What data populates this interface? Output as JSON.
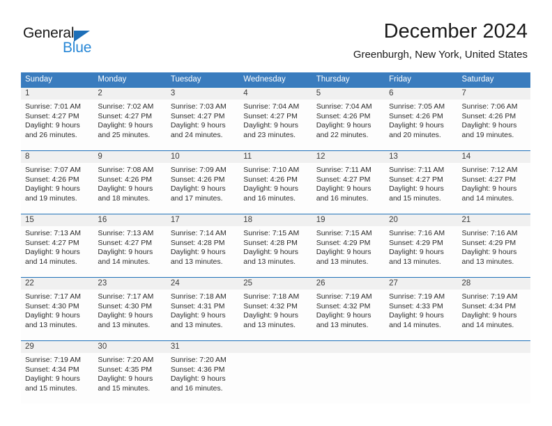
{
  "brand": {
    "name_part1": "General",
    "name_part2": "Blue",
    "accent_color": "#2787d6",
    "triangle_color": "#1d6fb8"
  },
  "header": {
    "title": "December 2024",
    "subtitle": "Greenburgh, New York, United States"
  },
  "calendar": {
    "header_bg": "#3a7cbe",
    "row_divider_color": "#1d6fb8",
    "daynum_bg": "#f0f0f0",
    "weekdays": [
      "Sunday",
      "Monday",
      "Tuesday",
      "Wednesday",
      "Thursday",
      "Friday",
      "Saturday"
    ],
    "weeks": [
      [
        {
          "day": "1",
          "sunrise": "Sunrise: 7:01 AM",
          "sunset": "Sunset: 4:27 PM",
          "daylight_1": "Daylight: 9 hours",
          "daylight_2": "and 26 minutes."
        },
        {
          "day": "2",
          "sunrise": "Sunrise: 7:02 AM",
          "sunset": "Sunset: 4:27 PM",
          "daylight_1": "Daylight: 9 hours",
          "daylight_2": "and 25 minutes."
        },
        {
          "day": "3",
          "sunrise": "Sunrise: 7:03 AM",
          "sunset": "Sunset: 4:27 PM",
          "daylight_1": "Daylight: 9 hours",
          "daylight_2": "and 24 minutes."
        },
        {
          "day": "4",
          "sunrise": "Sunrise: 7:04 AM",
          "sunset": "Sunset: 4:27 PM",
          "daylight_1": "Daylight: 9 hours",
          "daylight_2": "and 23 minutes."
        },
        {
          "day": "5",
          "sunrise": "Sunrise: 7:04 AM",
          "sunset": "Sunset: 4:26 PM",
          "daylight_1": "Daylight: 9 hours",
          "daylight_2": "and 22 minutes."
        },
        {
          "day": "6",
          "sunrise": "Sunrise: 7:05 AM",
          "sunset": "Sunset: 4:26 PM",
          "daylight_1": "Daylight: 9 hours",
          "daylight_2": "and 20 minutes."
        },
        {
          "day": "7",
          "sunrise": "Sunrise: 7:06 AM",
          "sunset": "Sunset: 4:26 PM",
          "daylight_1": "Daylight: 9 hours",
          "daylight_2": "and 19 minutes."
        }
      ],
      [
        {
          "day": "8",
          "sunrise": "Sunrise: 7:07 AM",
          "sunset": "Sunset: 4:26 PM",
          "daylight_1": "Daylight: 9 hours",
          "daylight_2": "and 19 minutes."
        },
        {
          "day": "9",
          "sunrise": "Sunrise: 7:08 AM",
          "sunset": "Sunset: 4:26 PM",
          "daylight_1": "Daylight: 9 hours",
          "daylight_2": "and 18 minutes."
        },
        {
          "day": "10",
          "sunrise": "Sunrise: 7:09 AM",
          "sunset": "Sunset: 4:26 PM",
          "daylight_1": "Daylight: 9 hours",
          "daylight_2": "and 17 minutes."
        },
        {
          "day": "11",
          "sunrise": "Sunrise: 7:10 AM",
          "sunset": "Sunset: 4:26 PM",
          "daylight_1": "Daylight: 9 hours",
          "daylight_2": "and 16 minutes."
        },
        {
          "day": "12",
          "sunrise": "Sunrise: 7:11 AM",
          "sunset": "Sunset: 4:27 PM",
          "daylight_1": "Daylight: 9 hours",
          "daylight_2": "and 16 minutes."
        },
        {
          "day": "13",
          "sunrise": "Sunrise: 7:11 AM",
          "sunset": "Sunset: 4:27 PM",
          "daylight_1": "Daylight: 9 hours",
          "daylight_2": "and 15 minutes."
        },
        {
          "day": "14",
          "sunrise": "Sunrise: 7:12 AM",
          "sunset": "Sunset: 4:27 PM",
          "daylight_1": "Daylight: 9 hours",
          "daylight_2": "and 14 minutes."
        }
      ],
      [
        {
          "day": "15",
          "sunrise": "Sunrise: 7:13 AM",
          "sunset": "Sunset: 4:27 PM",
          "daylight_1": "Daylight: 9 hours",
          "daylight_2": "and 14 minutes."
        },
        {
          "day": "16",
          "sunrise": "Sunrise: 7:13 AM",
          "sunset": "Sunset: 4:27 PM",
          "daylight_1": "Daylight: 9 hours",
          "daylight_2": "and 14 minutes."
        },
        {
          "day": "17",
          "sunrise": "Sunrise: 7:14 AM",
          "sunset": "Sunset: 4:28 PM",
          "daylight_1": "Daylight: 9 hours",
          "daylight_2": "and 13 minutes."
        },
        {
          "day": "18",
          "sunrise": "Sunrise: 7:15 AM",
          "sunset": "Sunset: 4:28 PM",
          "daylight_1": "Daylight: 9 hours",
          "daylight_2": "and 13 minutes."
        },
        {
          "day": "19",
          "sunrise": "Sunrise: 7:15 AM",
          "sunset": "Sunset: 4:29 PM",
          "daylight_1": "Daylight: 9 hours",
          "daylight_2": "and 13 minutes."
        },
        {
          "day": "20",
          "sunrise": "Sunrise: 7:16 AM",
          "sunset": "Sunset: 4:29 PM",
          "daylight_1": "Daylight: 9 hours",
          "daylight_2": "and 13 minutes."
        },
        {
          "day": "21",
          "sunrise": "Sunrise: 7:16 AM",
          "sunset": "Sunset: 4:29 PM",
          "daylight_1": "Daylight: 9 hours",
          "daylight_2": "and 13 minutes."
        }
      ],
      [
        {
          "day": "22",
          "sunrise": "Sunrise: 7:17 AM",
          "sunset": "Sunset: 4:30 PM",
          "daylight_1": "Daylight: 9 hours",
          "daylight_2": "and 13 minutes."
        },
        {
          "day": "23",
          "sunrise": "Sunrise: 7:17 AM",
          "sunset": "Sunset: 4:30 PM",
          "daylight_1": "Daylight: 9 hours",
          "daylight_2": "and 13 minutes."
        },
        {
          "day": "24",
          "sunrise": "Sunrise: 7:18 AM",
          "sunset": "Sunset: 4:31 PM",
          "daylight_1": "Daylight: 9 hours",
          "daylight_2": "and 13 minutes."
        },
        {
          "day": "25",
          "sunrise": "Sunrise: 7:18 AM",
          "sunset": "Sunset: 4:32 PM",
          "daylight_1": "Daylight: 9 hours",
          "daylight_2": "and 13 minutes."
        },
        {
          "day": "26",
          "sunrise": "Sunrise: 7:19 AM",
          "sunset": "Sunset: 4:32 PM",
          "daylight_1": "Daylight: 9 hours",
          "daylight_2": "and 13 minutes."
        },
        {
          "day": "27",
          "sunrise": "Sunrise: 7:19 AM",
          "sunset": "Sunset: 4:33 PM",
          "daylight_1": "Daylight: 9 hours",
          "daylight_2": "and 14 minutes."
        },
        {
          "day": "28",
          "sunrise": "Sunrise: 7:19 AM",
          "sunset": "Sunset: 4:34 PM",
          "daylight_1": "Daylight: 9 hours",
          "daylight_2": "and 14 minutes."
        }
      ],
      [
        {
          "day": "29",
          "sunrise": "Sunrise: 7:19 AM",
          "sunset": "Sunset: 4:34 PM",
          "daylight_1": "Daylight: 9 hours",
          "daylight_2": "and 15 minutes."
        },
        {
          "day": "30",
          "sunrise": "Sunrise: 7:20 AM",
          "sunset": "Sunset: 4:35 PM",
          "daylight_1": "Daylight: 9 hours",
          "daylight_2": "and 15 minutes."
        },
        {
          "day": "31",
          "sunrise": "Sunrise: 7:20 AM",
          "sunset": "Sunset: 4:36 PM",
          "daylight_1": "Daylight: 9 hours",
          "daylight_2": "and 16 minutes."
        },
        {
          "day": "",
          "sunrise": "",
          "sunset": "",
          "daylight_1": "",
          "daylight_2": ""
        },
        {
          "day": "",
          "sunrise": "",
          "sunset": "",
          "daylight_1": "",
          "daylight_2": ""
        },
        {
          "day": "",
          "sunrise": "",
          "sunset": "",
          "daylight_1": "",
          "daylight_2": ""
        },
        {
          "day": "",
          "sunrise": "",
          "sunset": "",
          "daylight_1": "",
          "daylight_2": ""
        }
      ]
    ]
  }
}
